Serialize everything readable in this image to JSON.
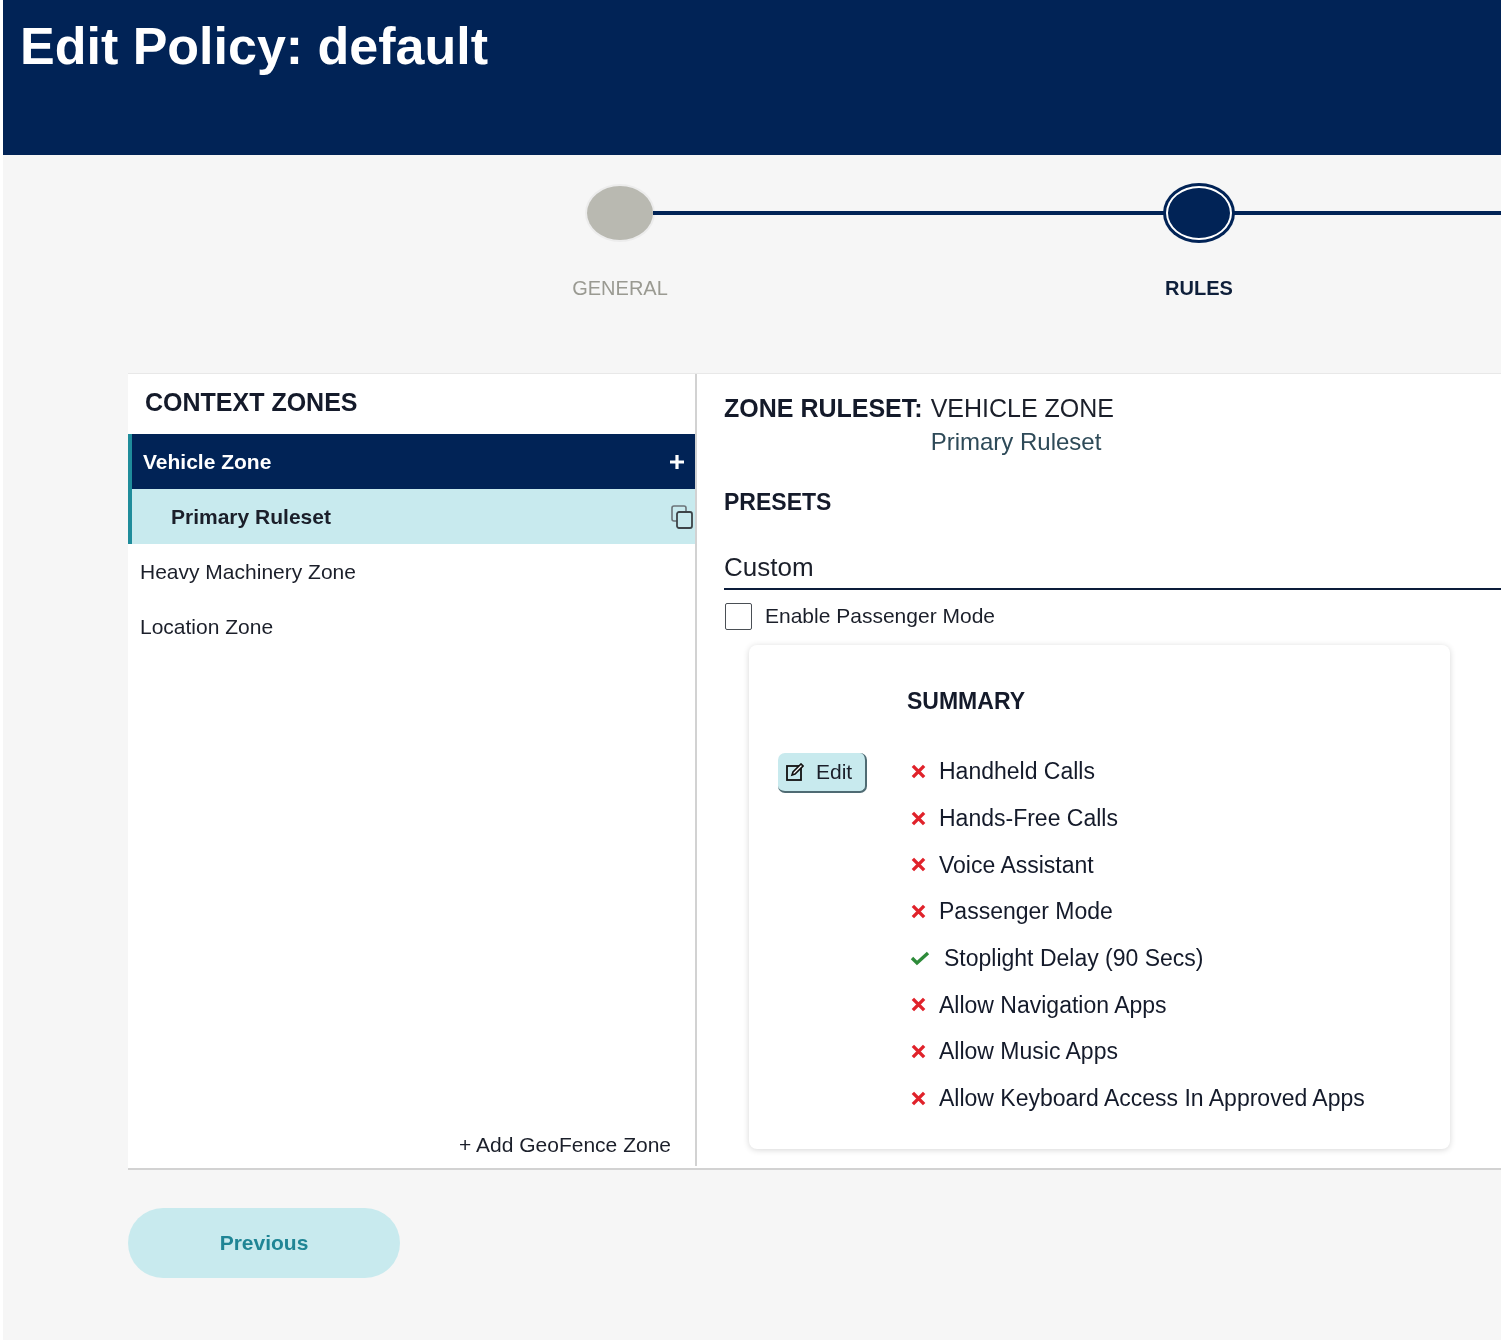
{
  "header": {
    "title": "Edit Policy: default"
  },
  "steps": [
    {
      "label": "GENERAL",
      "selected": false
    },
    {
      "label": "RULES",
      "selected": true
    }
  ],
  "context_zones": {
    "title": "CONTEXT ZONES",
    "zones": [
      {
        "label": "Vehicle Zone",
        "selected": true,
        "children": [
          {
            "label": "Primary Ruleset",
            "selected": true
          }
        ]
      },
      {
        "label": "Heavy Machinery Zone",
        "selected": false
      },
      {
        "label": "Location Zone",
        "selected": false
      }
    ],
    "add_link": "+ Add GeoFence Zone"
  },
  "ruleset": {
    "label": "ZONE RULESET:",
    "zone": "VEHICLE ZONE",
    "name": "Primary Ruleset",
    "presets_title": "PRESETS",
    "preset": {
      "value": "Custom"
    },
    "passenger_mode": {
      "label": "Enable Passenger Mode",
      "checked": false
    },
    "summary": {
      "title": "SUMMARY",
      "edit_button": "Edit",
      "items": [
        {
          "label": "Handheld Calls",
          "allowed": false
        },
        {
          "label": "Hands-Free Calls",
          "allowed": false
        },
        {
          "label": "Voice Assistant",
          "allowed": false
        },
        {
          "label": "Passenger Mode",
          "allowed": false
        },
        {
          "label": "Stoplight Delay (90 Secs)",
          "allowed": true
        },
        {
          "label": "Allow Navigation Apps",
          "allowed": false
        },
        {
          "label": "Allow Music Apps",
          "allowed": false
        },
        {
          "label": "Allow Keyboard Access In Approved Apps",
          "allowed": false
        }
      ]
    }
  },
  "footer": {
    "previous_button": "Previous"
  }
}
